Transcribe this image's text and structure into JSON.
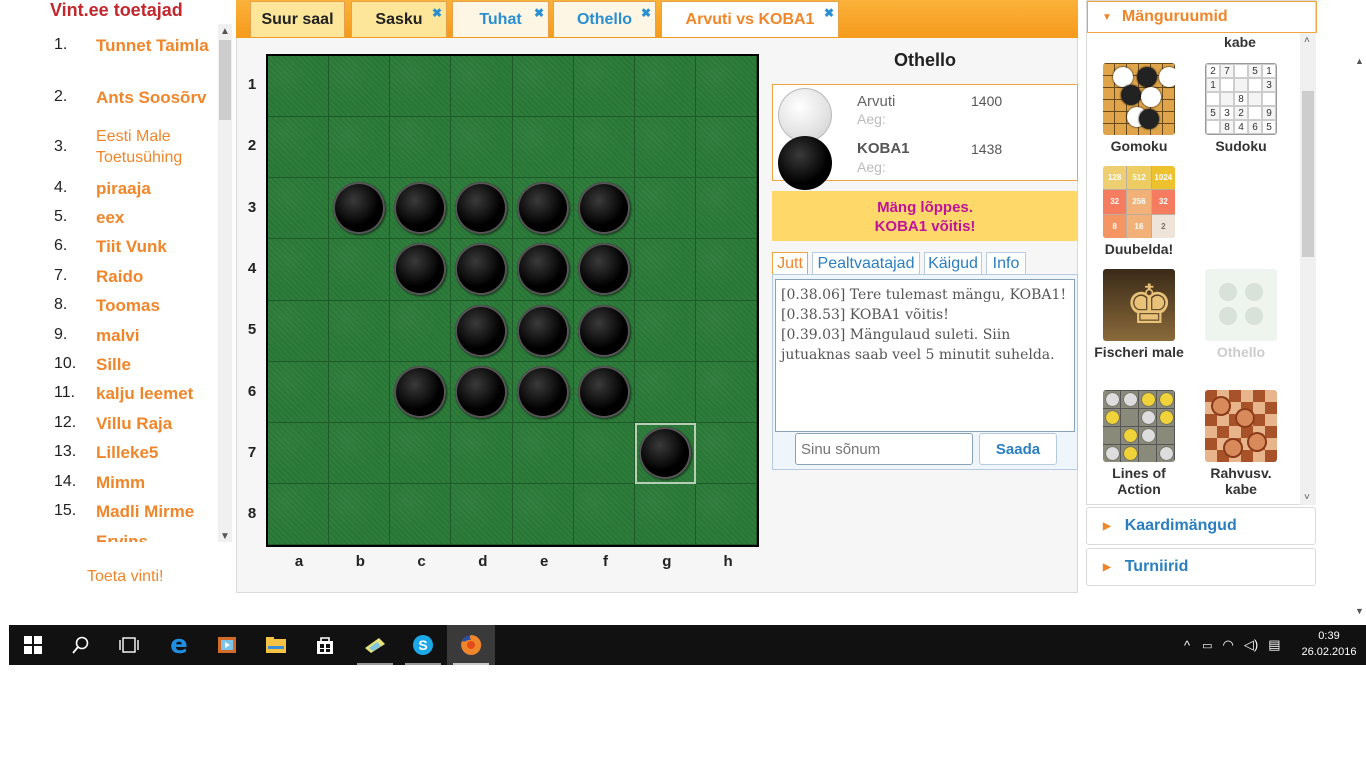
{
  "sidebar": {
    "title": "Vint.ee toetajad",
    "supporters": [
      {
        "num": "1.",
        "name": "Tunnet Taimla"
      },
      {
        "num": "2.",
        "name": "Ants Soosõrv"
      },
      {
        "num": "3.",
        "name": "Eesti Male Toetusühing"
      },
      {
        "num": "4.",
        "name": "piraaja"
      },
      {
        "num": "5.",
        "name": "eex"
      },
      {
        "num": "6.",
        "name": "Tiit Vunk"
      },
      {
        "num": "7.",
        "name": "Raido"
      },
      {
        "num": "8.",
        "name": "Toomas"
      },
      {
        "num": "9.",
        "name": "malvi"
      },
      {
        "num": "10.",
        "name": "Sille"
      },
      {
        "num": "11.",
        "name": "kalju leemet"
      },
      {
        "num": "12.",
        "name": "Villu Raja"
      },
      {
        "num": "13.",
        "name": "Lilleke5"
      },
      {
        "num": "14.",
        "name": "Mimm"
      },
      {
        "num": "15.",
        "name": "Madli Mirme"
      },
      {
        "num": "",
        "name": "Ervins"
      }
    ],
    "support_link": "Toeta vinti!"
  },
  "tabs": [
    {
      "label": "Suur saal",
      "closable": false,
      "style": "yellow"
    },
    {
      "label": "Sasku",
      "closable": true,
      "style": "yellow"
    },
    {
      "label": "Tuhat",
      "closable": true,
      "style": "light"
    },
    {
      "label": "Othello",
      "closable": true,
      "style": "light"
    },
    {
      "label": "Arvuti vs KOBA1",
      "closable": true,
      "style": "active"
    }
  ],
  "tab_close_glyph": "✖",
  "board": {
    "rows": [
      "1",
      "2",
      "3",
      "4",
      "5",
      "6",
      "7",
      "8"
    ],
    "cols": [
      "a",
      "b",
      "c",
      "d",
      "e",
      "f",
      "g",
      "h"
    ],
    "black_discs": [
      "b3",
      "c3",
      "d3",
      "e3",
      "f3",
      "c4",
      "d4",
      "e4",
      "f4",
      "d5",
      "e5",
      "f5",
      "c6",
      "d6",
      "e6",
      "f6",
      "g7"
    ],
    "white_discs": [],
    "last_move": "g7"
  },
  "game": {
    "title": "Othello",
    "players": [
      {
        "name": "Arvuti",
        "rating": "1400",
        "time_label": "Aeg:",
        "color": "white"
      },
      {
        "name": "KOBA1",
        "rating": "1438",
        "time_label": "Aeg:",
        "color": "black"
      }
    ],
    "status_line1": "Mäng lõppes.",
    "status_line2": "KOBA1 võitis!"
  },
  "chat": {
    "tabs": [
      "Jutt",
      "Pealtvaatajad",
      "Käigud",
      "Info"
    ],
    "active_tab": "Jutt",
    "messages": [
      "[0.38.06] Tere tulemast mängu, KOBA1!",
      "[0.38.53] KOBA1 võitis!",
      "[0.39.03] Mängulaud suleti. Siin jutuaknas saab veel 5 minutit suhelda."
    ],
    "input_placeholder": "Sinu sõnum",
    "send_label": "Saada"
  },
  "rooms": {
    "header": "Mänguruumid",
    "top_cut_label": "kabe",
    "games": [
      {
        "label": "Gomoku",
        "icon": "gomoku-icon"
      },
      {
        "label": "Sudoku",
        "icon": "sudoku-icon"
      },
      {
        "label": "Duubelda!",
        "icon": "2048-icon"
      },
      {
        "label": "Fischeri male",
        "icon": "chess-icon"
      },
      {
        "label": "Othello",
        "icon": "othello-icon",
        "disabled": true
      },
      {
        "label": "Lines of Action",
        "icon": "lines-of-action-icon"
      },
      {
        "label": "Rahvusv. kabe",
        "icon": "checkers-icon"
      }
    ],
    "sudoku_digits": [
      "2",
      "7",
      "",
      "5",
      "1",
      "1",
      "",
      "",
      "",
      "3",
      "",
      "",
      "8",
      "",
      "",
      "5",
      "3",
      "2",
      "",
      "9",
      "",
      "8",
      "4",
      "6",
      "5"
    ],
    "duubelda_tiles": [
      "128",
      "512",
      "1024",
      "32",
      "256",
      "32",
      "8",
      "16",
      "2"
    ]
  },
  "accordion": [
    {
      "label": "Kaardimängud"
    },
    {
      "label": "Turniirid"
    }
  ],
  "taskbar": {
    "time": "0:39",
    "date": "26.02.2016"
  },
  "colors": {
    "accent_orange": "#f0862a",
    "link_blue": "#2a7fbf",
    "board_green": "#2a7a38",
    "status_magenta": "#c0139b",
    "title_red": "#c1272d"
  }
}
